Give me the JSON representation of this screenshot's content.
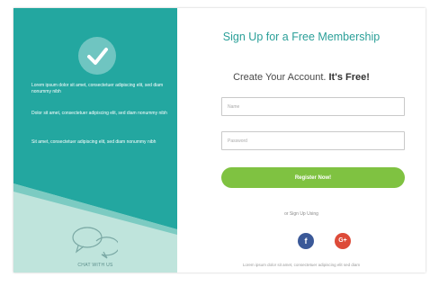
{
  "colors": {
    "teal": "#23a7a0",
    "teal_light": "#bfe4dc",
    "green_button": "#7fc241",
    "facebook": "#3b5998",
    "google_plus": "#dd4b39",
    "title_color": "#2a9f98"
  },
  "left_panel": {
    "check_icon": "check-icon",
    "paragraphs": [
      "Lorem ipsum dolor sit amet, consectetuer adipiscing elit, sed diam nonummy nibh",
      "Dolor sit amet, consectetuer adipiscing elit, sed diam nonummy nibh",
      "Sit amet, consectetuer adipiscing elit, sed diam nonummy nibh"
    ],
    "chat_icon": "chat-bubbles-icon",
    "chat_label": "CHAT WITH US"
  },
  "form": {
    "title": "Sign Up for a Free Membership",
    "subtitle_prefix": "Create Your Account. ",
    "subtitle_emphasis": "It's Free!",
    "name_placeholder": "Name",
    "password_placeholder": "Password",
    "register_label": "Register Now!",
    "or_text": "or Sign Up Using",
    "facebook_glyph": "f",
    "google_glyph": "G+",
    "footer_text": "Lorem ipsum dolor sit amet, consectetuer adipiscing elit sed diam"
  }
}
